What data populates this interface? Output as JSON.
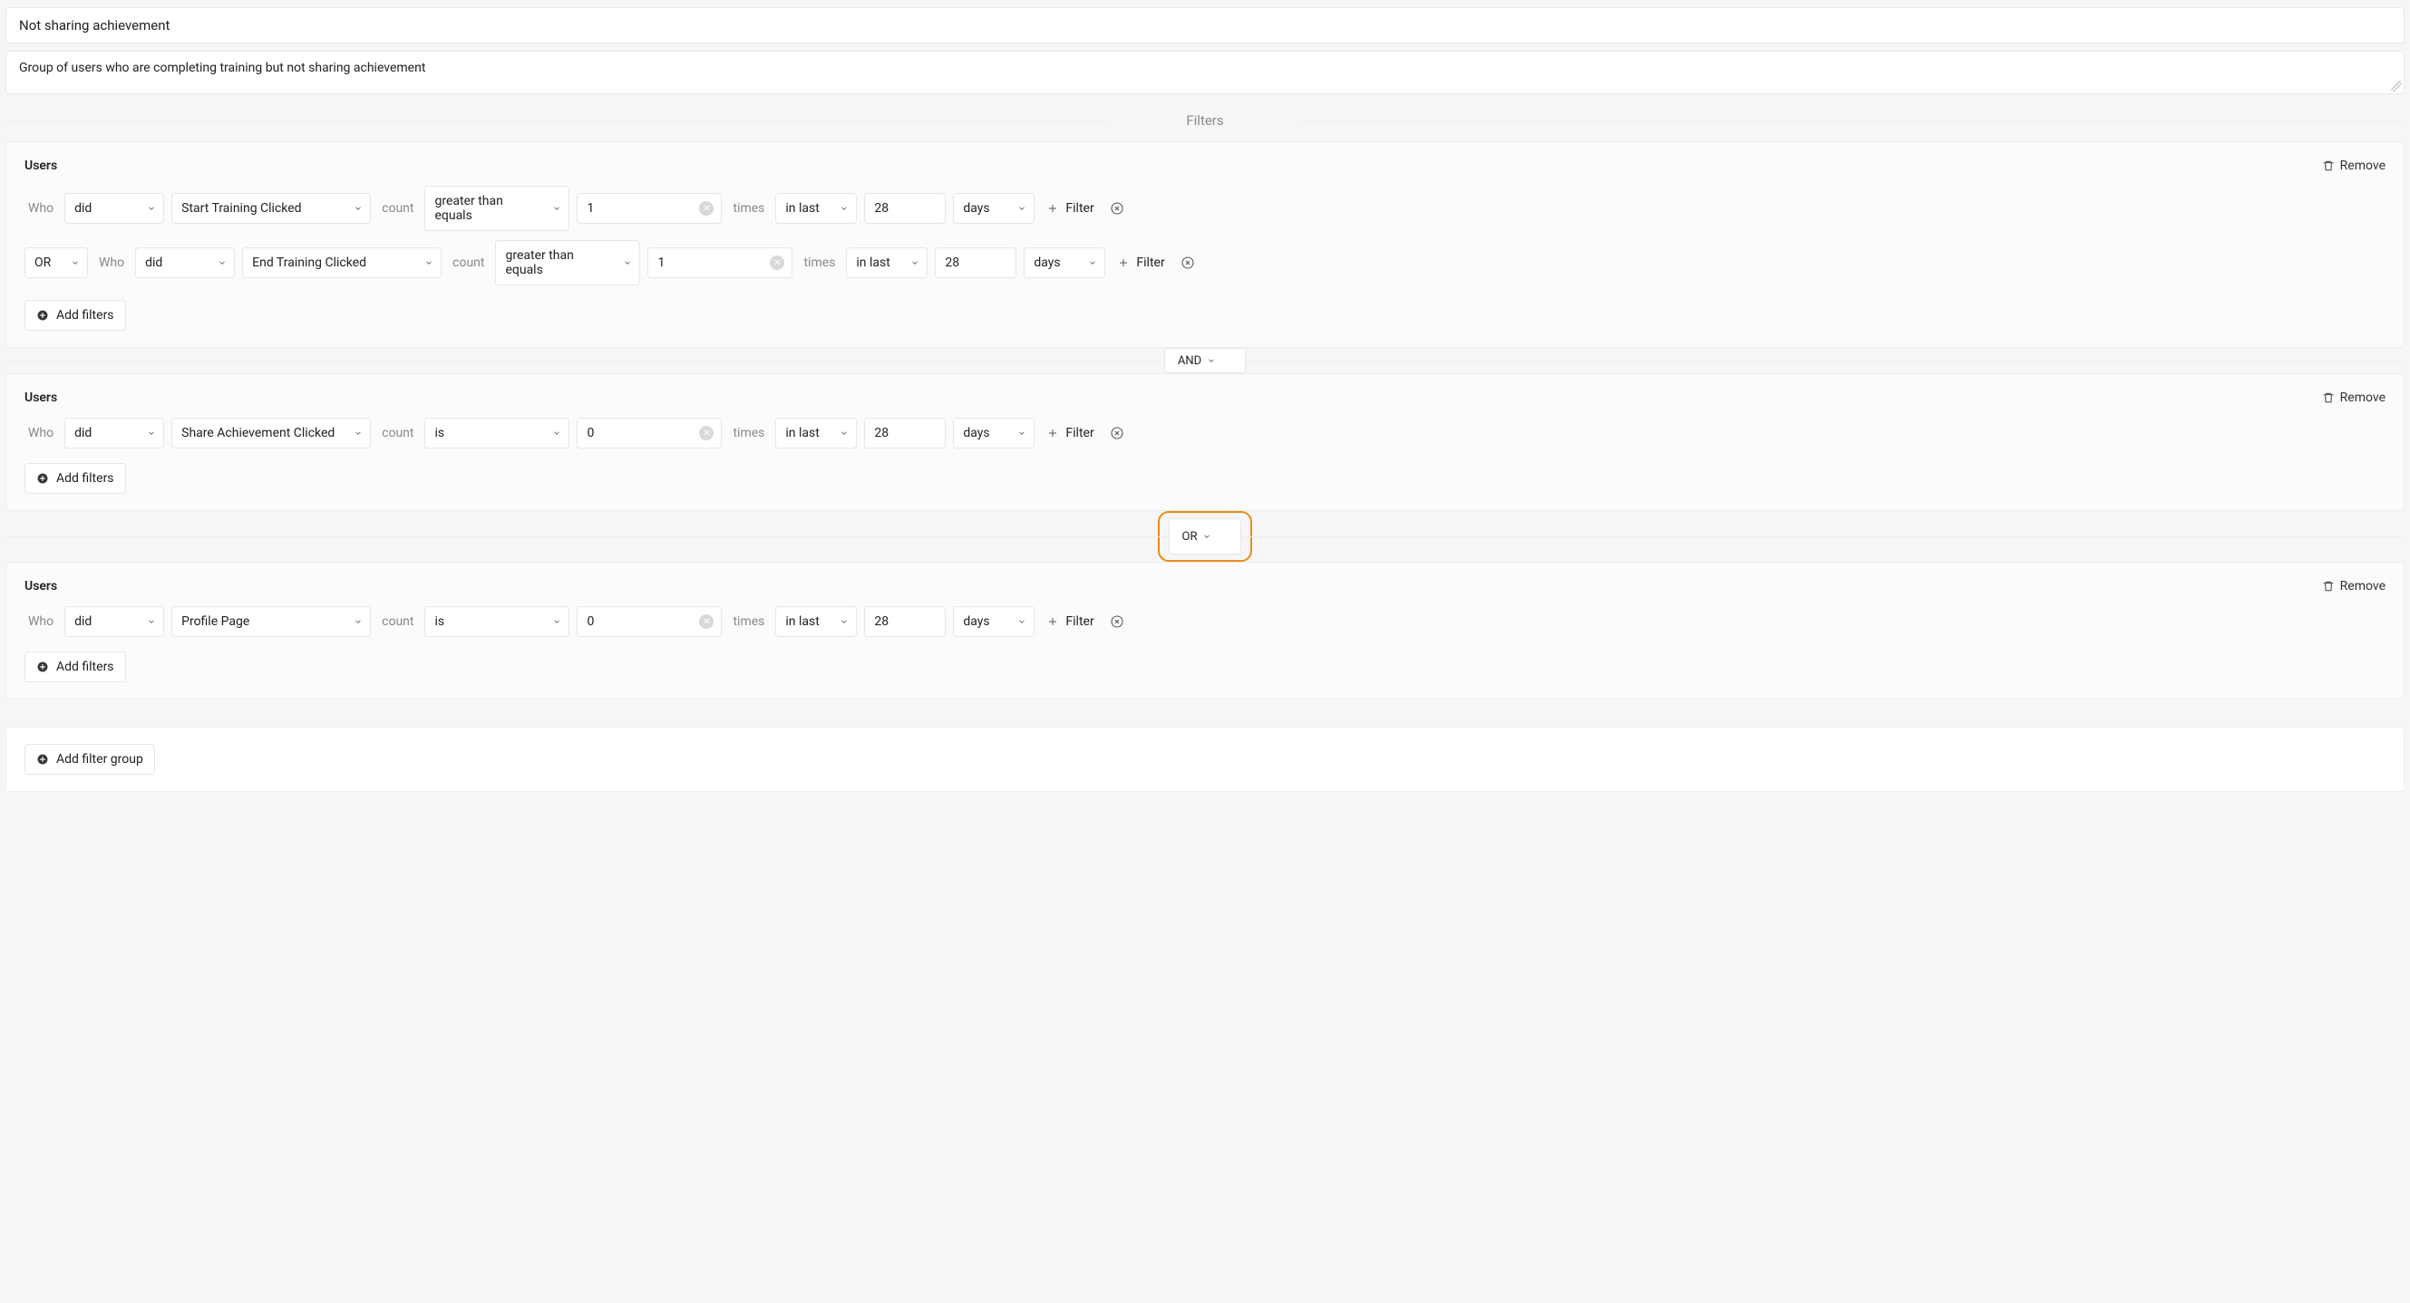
{
  "cohort_name": "Not sharing achievement",
  "cohort_description": "Group of users who are completing training but not sharing achievement",
  "filters_section_title": "Filters",
  "labels": {
    "who": "Who",
    "count": "count",
    "times": "times",
    "filter": "Filter",
    "add_filters": "Add filters",
    "add_filter_group": "Add filter group",
    "remove": "Remove"
  },
  "groups": [
    {
      "title": "Users",
      "rows": [
        {
          "prefix_op": null,
          "verb": "did",
          "event": "Start Training Clicked",
          "comparator": "greater than equals",
          "value": "1",
          "time_op": "in last",
          "time_value": "28",
          "time_unit": "days"
        },
        {
          "prefix_op": "OR",
          "verb": "did",
          "event": "End Training Clicked",
          "comparator": "greater than equals",
          "value": "1",
          "time_op": "in last",
          "time_value": "28",
          "time_unit": "days"
        }
      ],
      "connector_after": "AND",
      "connector_highlight": false
    },
    {
      "title": "Users",
      "rows": [
        {
          "prefix_op": null,
          "verb": "did",
          "event": "Share Achievement Clicked",
          "comparator": "is",
          "value": "0",
          "time_op": "in last",
          "time_value": "28",
          "time_unit": "days"
        }
      ],
      "connector_after": "OR",
      "connector_highlight": true
    },
    {
      "title": "Users",
      "rows": [
        {
          "prefix_op": null,
          "verb": "did",
          "event": "Profile Page",
          "comparator": "is",
          "value": "0",
          "time_op": "in last",
          "time_value": "28",
          "time_unit": "days"
        }
      ],
      "connector_after": null,
      "connector_highlight": false
    }
  ]
}
